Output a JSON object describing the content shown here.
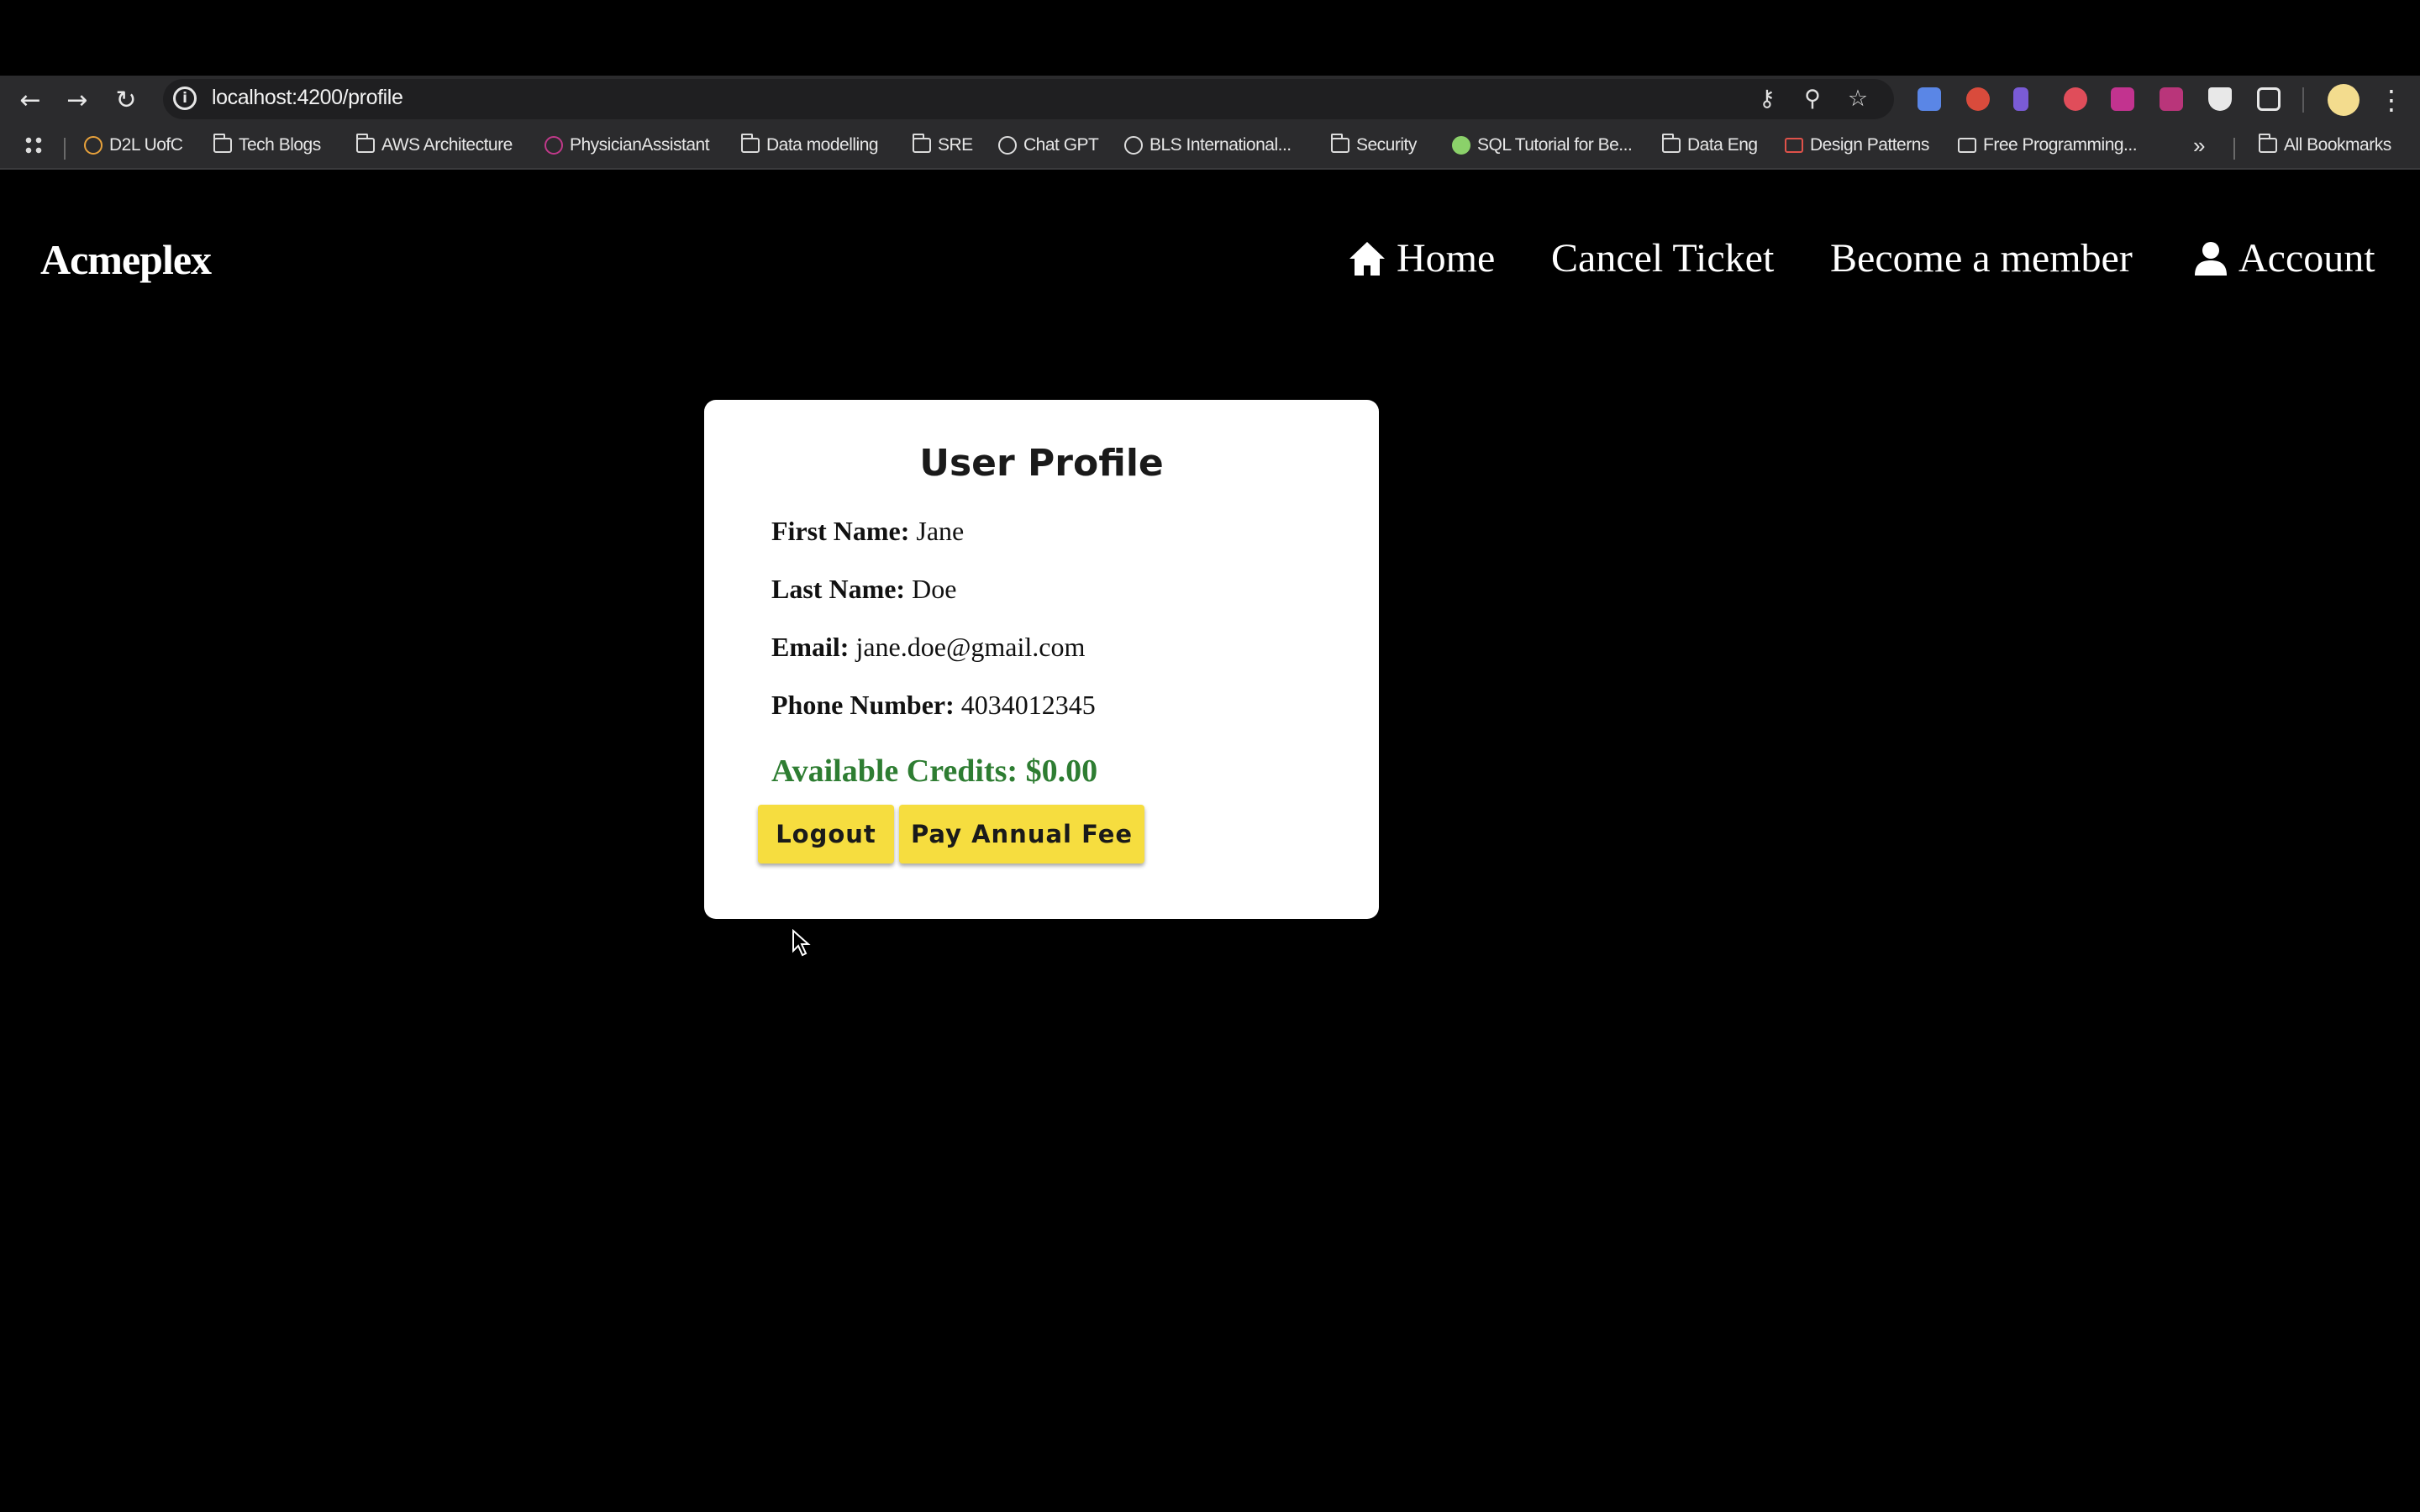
{
  "browser": {
    "url": "localhost:4200/profile",
    "bookmarks": [
      "D2L UofC",
      "Tech Blogs",
      "AWS Architecture",
      "PhysicianAssistant",
      "Data modelling",
      "SRE",
      "Chat GPT",
      "BLS International...",
      "Security",
      "SQL Tutorial for Be...",
      "Data Eng",
      "Design Patterns",
      "Free Programming...",
      "All Bookmarks"
    ]
  },
  "app": {
    "brand": "Acmeplex",
    "nav": {
      "home": "Home",
      "cancel_ticket": "Cancel Ticket",
      "become_member": "Become a member",
      "account": "Account"
    }
  },
  "profile": {
    "title": "User Profile",
    "fields": [
      {
        "label": "First Name:",
        "value": "Jane"
      },
      {
        "label": "Last Name:",
        "value": "Doe"
      },
      {
        "label": "Email:",
        "value": "jane.doe@gmail.com"
      },
      {
        "label": "Phone Number:",
        "value": "4034012345"
      }
    ],
    "credits": "Available Credits: $0.00",
    "logout_label": "Logout",
    "pay_fee_label": "Pay Annual Fee"
  },
  "colors": {
    "accent_button": "#f6dd3f",
    "credits_text": "#2e7d32",
    "background": "#000000"
  }
}
